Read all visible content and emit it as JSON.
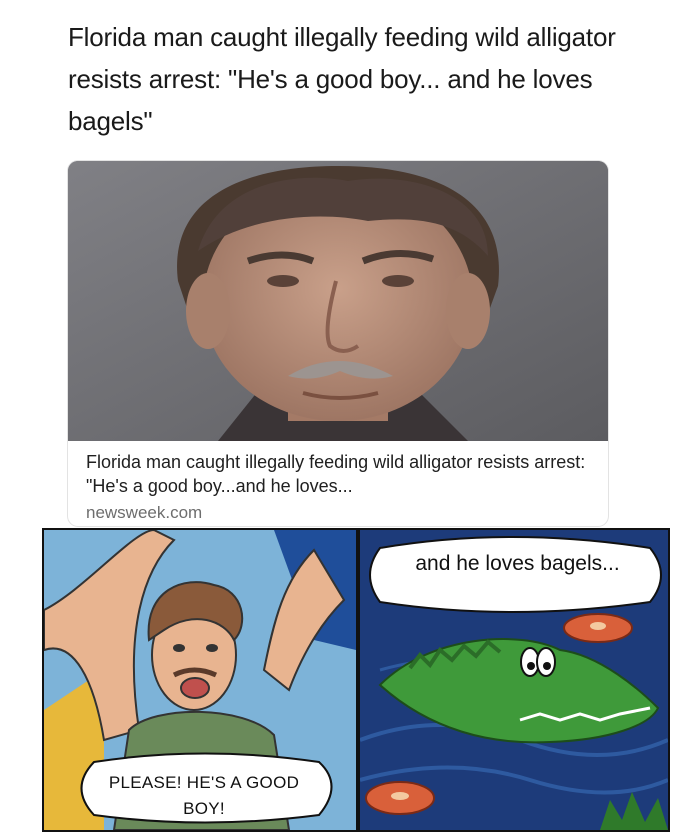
{
  "headline": "Florida man caught illegally feeding wild alligator resists arrest: \"He's a good boy... and he loves bagels\"",
  "card": {
    "caption": "Florida man caught illegally feeding wild alligator resists arrest: \"He's a good boy...and he loves...",
    "source": "newsweek.com"
  },
  "comic": {
    "left_bubble": "PLEASE! HE'S A GOOD BOY!",
    "right_bubble": "and he loves bagels..."
  }
}
